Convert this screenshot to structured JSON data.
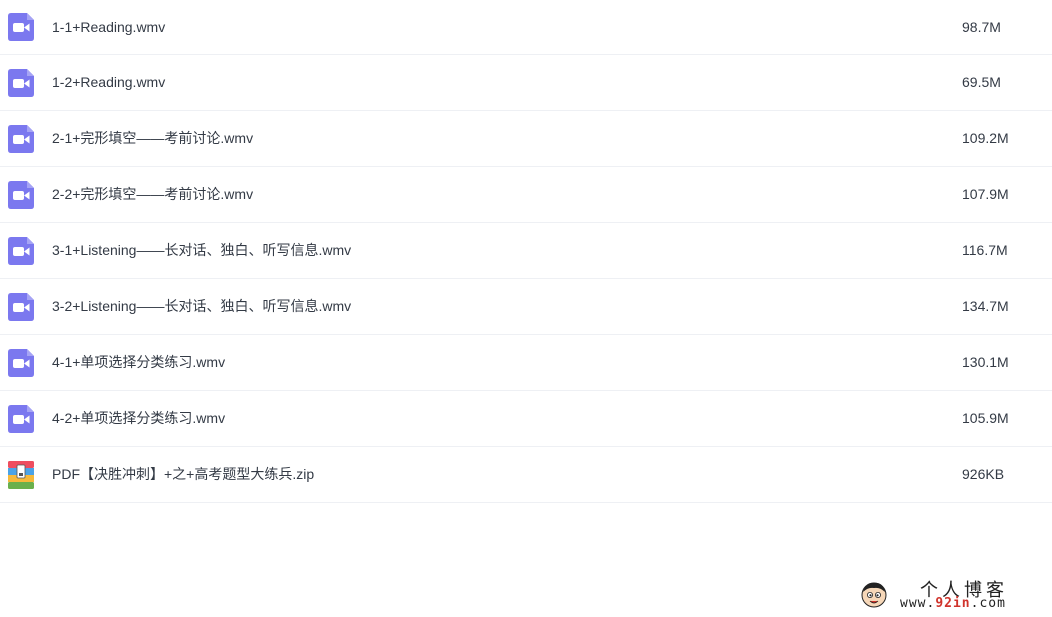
{
  "files": [
    {
      "name": "1-1+Reading.wmv",
      "size": "98.7M",
      "icon": "video-file-icon"
    },
    {
      "name": "1-2+Reading.wmv",
      "size": "69.5M",
      "icon": "video-file-icon"
    },
    {
      "name": "2-1+完形填空——考前讨论.wmv",
      "size": "109.2M",
      "icon": "video-file-icon"
    },
    {
      "name": "2-2+完形填空——考前讨论.wmv",
      "size": "107.9M",
      "icon": "video-file-icon"
    },
    {
      "name": "3-1+Listening——长对话、独白、听写信息.wmv",
      "size": "116.7M",
      "icon": "video-file-icon"
    },
    {
      "name": "3-2+Listening——长对话、独白、听写信息.wmv",
      "size": "134.7M",
      "icon": "video-file-icon"
    },
    {
      "name": "4-1+单项选择分类练习.wmv",
      "size": "130.1M",
      "icon": "video-file-icon"
    },
    {
      "name": "4-2+单项选择分类练习.wmv",
      "size": "105.9M",
      "icon": "video-file-icon"
    },
    {
      "name": "PDF【决胜冲刺】+之+高考题型大练兵.zip",
      "size": "926KB",
      "icon": "zip-archive-icon"
    }
  ],
  "watermark": {
    "title": "个人博客",
    "url_prefix": "www.",
    "url_accent": "92in",
    "url_suffix": ".com"
  },
  "colors": {
    "video_icon": "#7b78ef",
    "text": "#333a45",
    "divider": "#eef0f4"
  }
}
